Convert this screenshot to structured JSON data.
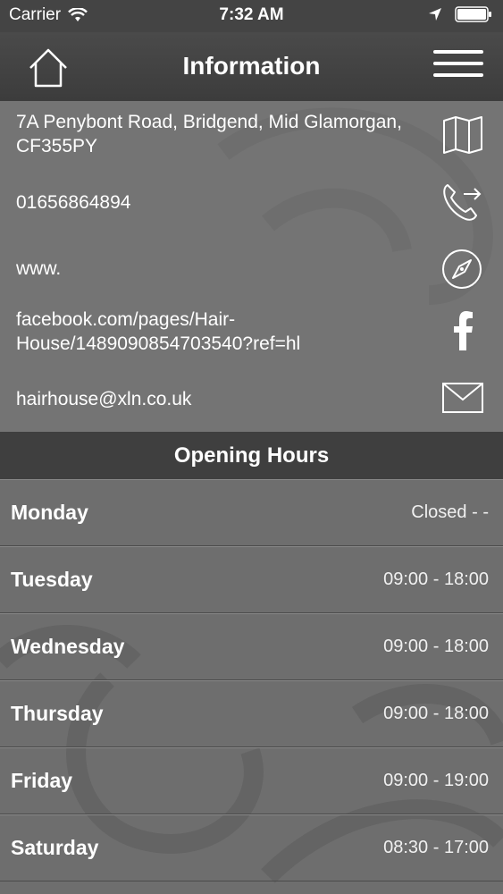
{
  "status_bar": {
    "carrier": "Carrier",
    "time": "7:32 AM"
  },
  "nav": {
    "title": "Information",
    "home_icon": "home-icon",
    "menu_icon": "hamburger-menu-icon"
  },
  "info": {
    "address": "7A Penybont Road, Bridgend, Mid Glamorgan, CF355PY",
    "phone": "01656864894",
    "website": "www.",
    "facebook": "facebook.com/pages/Hair-House/1489090854703540?ref=hl",
    "email": "hairhouse@xln.co.uk"
  },
  "hours": {
    "title": "Opening Hours",
    "days": [
      {
        "day": "Monday",
        "time": "Closed - -"
      },
      {
        "day": "Tuesday",
        "time": "09:00 - 18:00"
      },
      {
        "day": "Wednesday",
        "time": "09:00 - 18:00"
      },
      {
        "day": "Thursday",
        "time": "09:00 - 18:00"
      },
      {
        "day": "Friday",
        "time": "09:00 - 19:00"
      },
      {
        "day": "Saturday",
        "time": "08:30 - 17:00"
      }
    ]
  }
}
